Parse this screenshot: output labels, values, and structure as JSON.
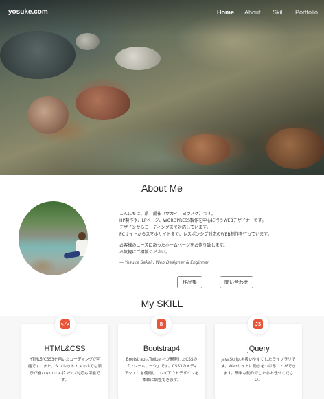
{
  "nav": {
    "brand": "yosuke.com",
    "links": [
      "Home",
      "About",
      "Skill",
      "Portfolio"
    ],
    "active": "Home"
  },
  "about": {
    "title": "About Me",
    "paragraph1": [
      "こんにちは、県　陽祐（サカイ　ヨウスケ）です。",
      "HP製作や、LPページ、WORDPRESS製作を中心に行うWEBデザイナーです。",
      "デザインからコーディングまで対応しています。",
      "PCサイトからスマホサイトまで、レスポンシブ対応のWEB制作を行っています。"
    ],
    "paragraph2": [
      "お客様のニーズにあったホームページをお作り致します。",
      "お気軽にご相談ください。"
    ],
    "signature": "— Yosuke Sakai , Web Designer & Enginner",
    "buttons": [
      "作品集",
      "問い合わせ"
    ]
  },
  "skill": {
    "title": "My SKILL",
    "cards": [
      {
        "icon": "html-code-icon",
        "icon_glyph": "</>",
        "title": "HTML&CSS",
        "text": "HTML5/CSS3を用いたコーディングが可能です。また、タブレット・スマホでも表示が崩れないレスポンシブ対応も可能です。"
      },
      {
        "icon": "bootstrap-icon",
        "icon_glyph": "B",
        "title": "Bootstrap4",
        "text": "BootstrapはTwitter社が開発したCSSの「フレームワーク」です。CSS3のメディアクエリを使用し、レイアウトデザインを柔軟に調整できます。"
      },
      {
        "icon": "js-icon",
        "icon_glyph": "JS",
        "title": "jQuery",
        "text": "JavaScriptを扱いやすくしたライブラリです。Webサイトに動きをつけることができます。簡単な動作でしたらお任せください。"
      }
    ]
  },
  "colors": {
    "accent": "#e8553a"
  }
}
